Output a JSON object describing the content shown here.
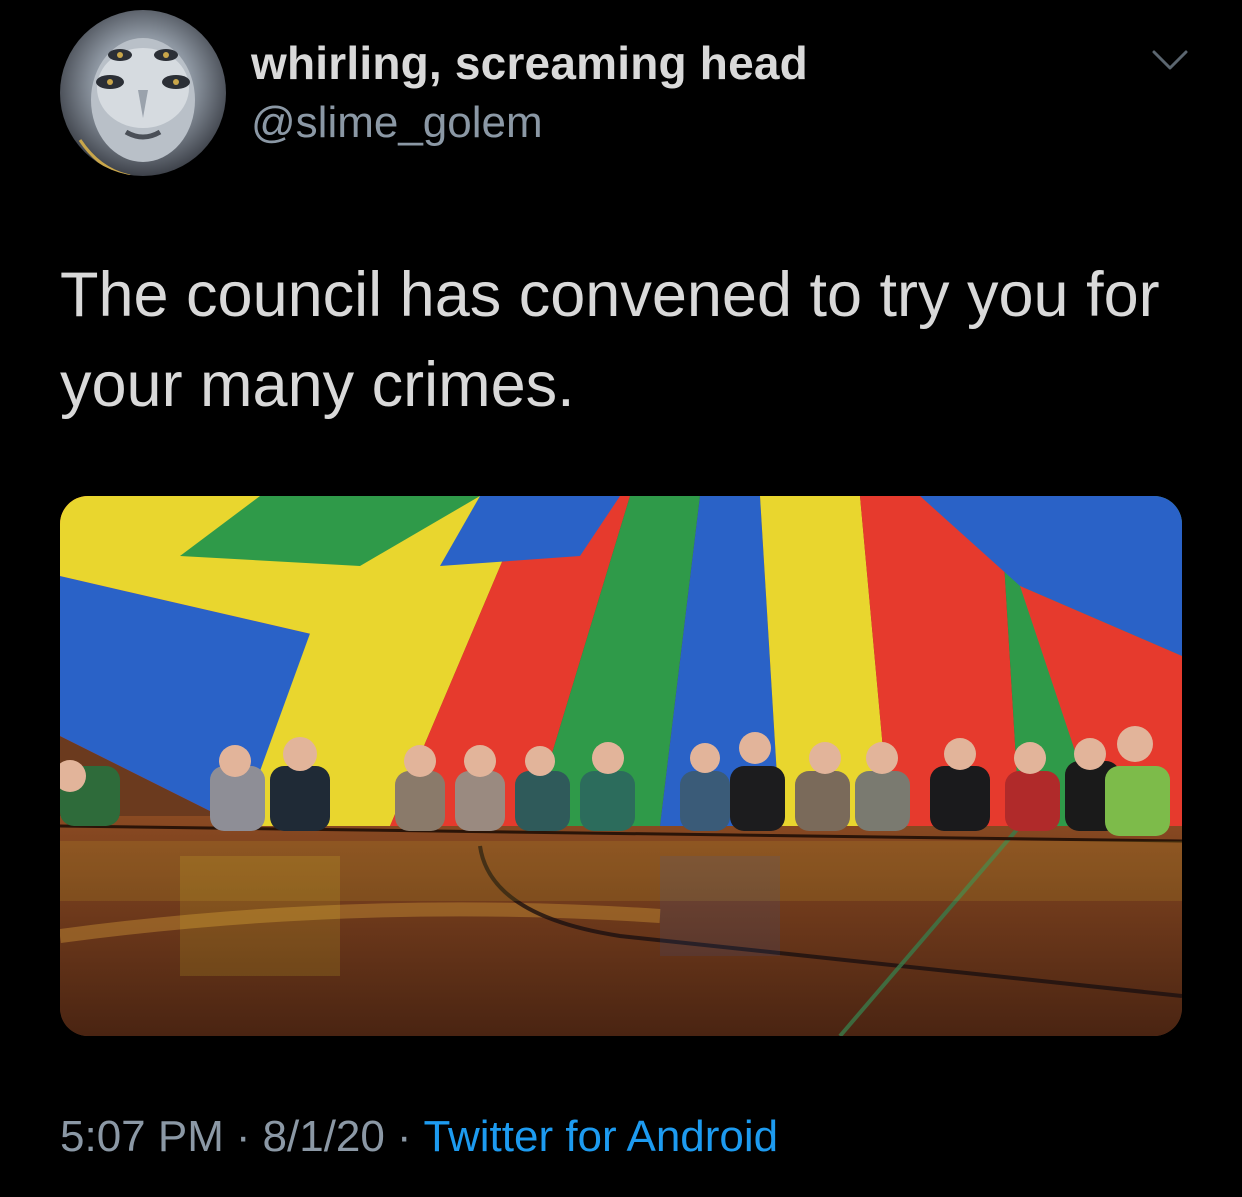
{
  "author": {
    "display_name": "whirling, screaming head",
    "handle": "@slime_golem",
    "avatar_icon": "face-avatar"
  },
  "tweet": {
    "text": "The council has convened to try you for your many crimes.",
    "media_alt_icon": "parachute-photo"
  },
  "meta": {
    "time": "5:07 PM",
    "date": "8/1/20",
    "separator": "·",
    "source": "Twitter for Android"
  },
  "colors": {
    "background": "#000000",
    "primary_text": "#d9d9d9",
    "secondary_text": "#8b98a5",
    "link": "#1d9bf0"
  }
}
